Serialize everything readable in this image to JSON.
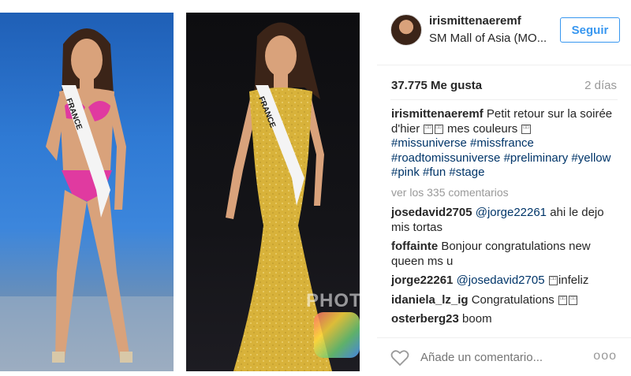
{
  "post": {
    "username": "irismittenaeremf",
    "location": "SM Mall of Asia (MO...",
    "follow_label": "Seguir",
    "likes": "37.775 Me gusta",
    "date": "2 días",
    "watermark": "PHOTO",
    "caption": {
      "user": "irismittenaeremf",
      "text_a": " Petit retour sur la soirée d'hier ",
      "text_b": " mes couleurs ",
      "hashtags": "#missuniverse #missfrance #roadtomissuniverse #preliminary #yellow #pink #fun #stage"
    },
    "view_all": "ver los 335 comentarios",
    "comments": [
      {
        "user": "josedavid2705",
        "mention": "@jorge22261",
        "text": " ahi le dejo mis tortas"
      },
      {
        "user": "foffainte",
        "mention": "",
        "text": " Bonjour congratulations new queen ms u"
      },
      {
        "user": "jorge22261",
        "mention": "@josedavid2705",
        "text": "infeliz"
      },
      {
        "user": "idaniela_lz_ig",
        "mention": "",
        "text": " Congratulations "
      },
      {
        "user": "osterberg23",
        "mention": "",
        "text": " boom"
      }
    ],
    "add_comment_placeholder": "Añade un comentario...",
    "more_label": "ooo",
    "sash_text": "FRANCE"
  },
  "colors": {
    "link": "#003569",
    "accent": "#3897f0",
    "muted": "#999999"
  },
  "icons": [
    "heart-icon",
    "more-options-icon",
    "avatar"
  ]
}
